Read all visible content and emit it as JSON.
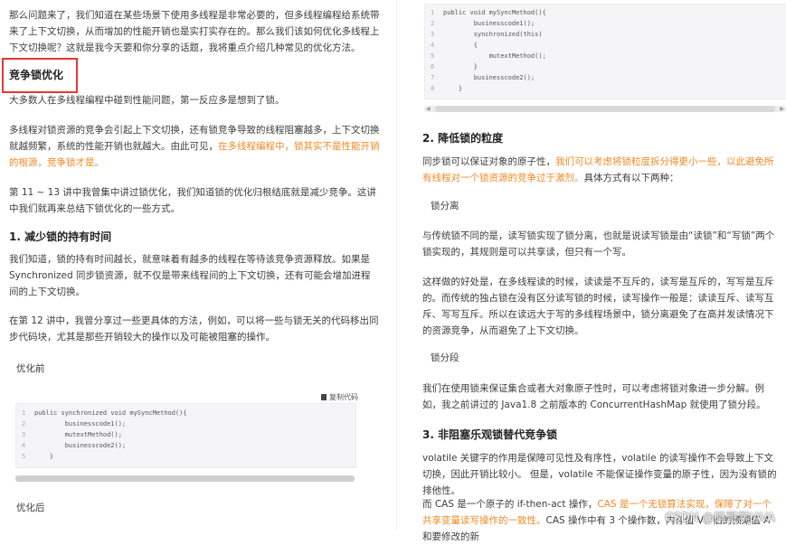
{
  "left": {
    "intro": "那么问题来了，我们知道在某些场景下使用多线程是非常必要的，但多线程编程给系统带来了上下文切换，从而增加的性能开销也是实打实存在的。那么我们该如何优化多线程上下文切换呢？这就是我今天要和你分享的话题，我将重点介绍几种常见的优化方法。",
    "section_title": "竞争锁优化",
    "p1": "大多数人在多线程编程中碰到性能问题，第一反应多是想到了锁。",
    "p2_a": "多线程对锁资源的竞争会引起上下文切换，还有锁竞争导致的线程阻塞越多，上下文切换就越频繁，系统的性能开销也就越大。由此可见，",
    "p2_b": "在多线程编程中，锁其实不是性能开销的根源，竞争锁才是。",
    "p3": "第 11 ~ 13 讲中我曾集中讲过锁优化，我们知道锁的优化归根结底就是减少竞争。这讲中我们就再来总结下锁优化的一些方式。",
    "h1": "1. 减少锁的持有时间",
    "p4": "我们知道，锁的持有时间越长，就意味着有越多的线程在等待该竞争资源释放。如果是 Synchronized 同步锁资源，就不仅是带来线程间的上下文切换，还有可能会增加进程间的上下文切换。",
    "p5": "在第 12 讲中，我曾分享过一些更具体的方法，例如，可以将一些与锁无关的代码移出同步代码块，尤其是那些开销较大的操作以及可能被阻塞的操作。",
    "before_label": "优化前",
    "copy_label": "复制代码",
    "code_lines": [
      "public synchronized void mySyncMethod(){",
      "        businesscode1();",
      "        mutextMethod();",
      "        businesscode2();",
      "    }"
    ],
    "line_numbers": [
      "1",
      "2",
      "3",
      "4",
      "5"
    ],
    "after_label": "优化后"
  },
  "right": {
    "code_lines": [
      "public void mySyncMethod(){",
      "        businesscode1();",
      "        synchronized(this)",
      "        {",
      "            mutextMethod();",
      "        }",
      "        businesscode2();",
      "    }"
    ],
    "line_numbers": [
      "1",
      "2",
      "3",
      "4",
      "5",
      "6",
      "7",
      "8"
    ],
    "h2": "2. 降低锁的粒度",
    "p6_a": "同步锁可以保证对象的原子性，",
    "p6_b": "我们可以考虑将锁粒度拆分得更小一些，以此避免所有线程对一个锁资源的竞争过于激烈。",
    "p6_c": "具体方式有以下两种：",
    "sub1": "锁分离",
    "p7": "与传统锁不同的是，读写锁实现了锁分离，也就是说读写锁是由“读锁”和“写锁”两个锁实现的，其规则是可以共享读，但只有一个写。",
    "p8": "这样做的好处是，在多线程读的时候，读读是不互斥的，读写是互斥的，写写是互斥的。而传统的独占锁在没有区分读写锁的时候，读写操作一般是：读读互斥、读写互斥、写写互斥。所以在读远大于写的多线程场景中，锁分离避免了在高并发读情况下的资源竞争，从而避免了上下文切换。",
    "sub2": "锁分段",
    "p9": "我们在使用锁来保证集合或者大对象原子性时，可以考虑将锁对象进一步分解。例如，我之前讲过的 Java1.8 之前版本的 ConcurrentHashMap 就使用了锁分段。",
    "h3": "3. 非阻塞乐观锁替代竞争锁",
    "p10": "volatile 关键字的作用是保障可见性及有序性，volatile 的读写操作不会导致上下文切换，因此开销比较小。 但是，volatile 不能保证操作变量的原子性，因为没有锁的排他性。",
    "p11_a": "而 CAS 是一个原子的 if-then-act 操作，",
    "p11_b": "CAS 是一个无锁算法实现，保障了对一个共享变量读写操作的一致性。",
    "p11_c": "CAS 操作中有 3 个操作数，内存值 V、旧的预期值 A 和要修改的新"
  },
  "watermark": "CSDN @码哥学JAVA"
}
